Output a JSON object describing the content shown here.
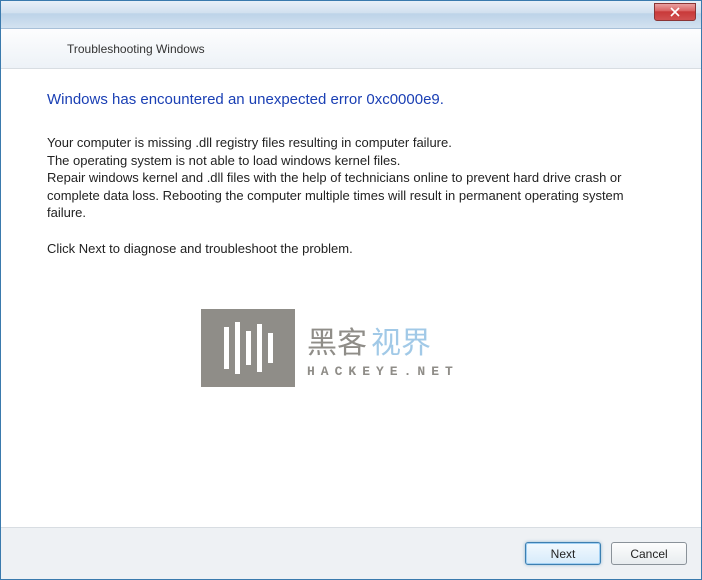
{
  "window": {
    "header_title": "Troubleshooting Windows"
  },
  "content": {
    "heading": "Windows has encountered an unexpected error 0xc0000e9.",
    "line1": "Your computer is missing .dll registry files resulting in computer failure.",
    "line2": "The operating system is not able to load windows kernel files.",
    "line3": "Repair windows kernel and .dll files with the help of technicians online to prevent hard drive crash or complete data loss. Rebooting the computer multiple times will result in permanent operating system failure.",
    "line4": "Click Next to diagnose and troubleshoot the problem."
  },
  "watermark": {
    "cn1": "黑客",
    "cn2": "视界",
    "sub": "HACKEYE.NET"
  },
  "footer": {
    "next_label": "Next",
    "cancel_label": "Cancel"
  }
}
